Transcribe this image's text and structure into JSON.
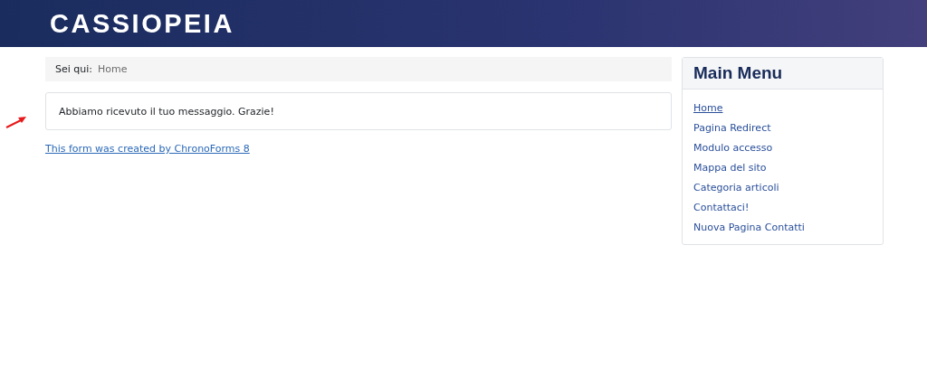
{
  "header": {
    "logo": "CASSIOPEIA"
  },
  "breadcrumb": {
    "label": "Sei qui:",
    "items": [
      "Home"
    ]
  },
  "message": {
    "text": "Abbiamo ricevuto il tuo messaggio. Grazie!",
    "annotated": true
  },
  "credit_link": "This form was created by ChronoForms 8",
  "sidebar": {
    "title": "Main Menu",
    "items": [
      {
        "label": "Home",
        "selected": true
      },
      {
        "label": "Pagina Redirect",
        "selected": false
      },
      {
        "label": "Modulo accesso",
        "selected": false
      },
      {
        "label": "Mappa del sito",
        "selected": false
      },
      {
        "label": "Categoria articoli",
        "selected": false
      },
      {
        "label": "Contattaci!",
        "selected": false
      },
      {
        "label": "Nuova Pagina Contatti",
        "selected": false
      }
    ]
  }
}
